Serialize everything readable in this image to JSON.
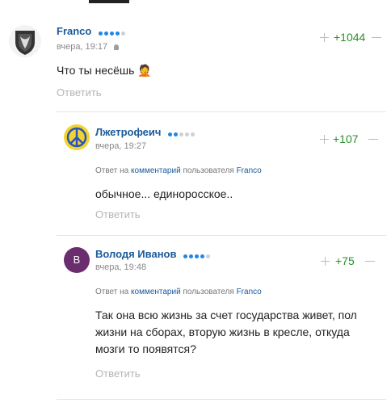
{
  "comments": [
    {
      "author": "Franco",
      "time": "вчера, 19:17",
      "text": "Что ты несёшь 🤦",
      "rating": "+1044",
      "answer_label": "Ответить",
      "level_dots": [
        "#1e88e5",
        "#1e88e5",
        "#1e88e5",
        "#1e88e5",
        "#d0d0d0"
      ],
      "device_icon": "android-icon"
    },
    {
      "author": "Лжетрофеич",
      "time": "вчера, 19:27",
      "reply_prefix": "Ответ на",
      "reply_link": "комментарий",
      "reply_mid": "пользователя",
      "reply_user": "Franco",
      "text": "обычное... единоросское..",
      "rating": "+107",
      "answer_label": "Ответить",
      "level_dots": [
        "#1e88e5",
        "#1e88e5",
        "#d0d0d0",
        "#d0d0d0",
        "#d0d0d0"
      ]
    },
    {
      "author": "Володя Иванов",
      "avatar_letter": "В",
      "avatar_color": "#6a2d6e",
      "time": "вчера, 19:48",
      "reply_prefix": "Ответ на",
      "reply_link": "комментарий",
      "reply_mid": "пользователя",
      "reply_user": "Franco",
      "text_lines": [
        "Так она всю жизнь за счет государства живет, пол",
        "жизни на сборах, вторую жизнь в кресле, откуда",
        "мозги то появятся?"
      ],
      "rating": "+75",
      "answer_label": "Ответить",
      "level_dots": [
        "#1e88e5",
        "#1e88e5",
        "#1e88e5",
        "#1e88e5",
        "#d0d0d0"
      ]
    }
  ]
}
